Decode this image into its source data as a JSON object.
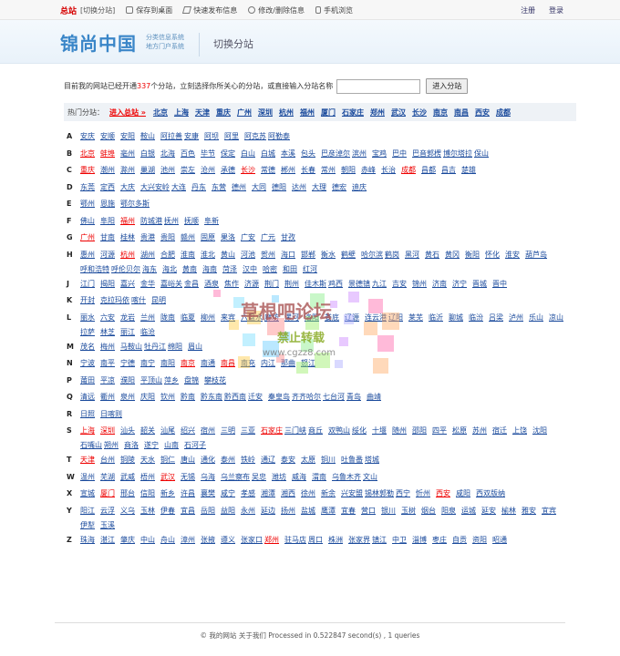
{
  "topbar": {
    "site_label": "总站",
    "switch_label": "[切换分站]",
    "tools": [
      {
        "icon": "monitor-icon",
        "label": "保存到桌面"
      },
      {
        "icon": "lightning-icon",
        "label": "快速发布信息"
      },
      {
        "icon": "gear-icon",
        "label": "修改/删除信息"
      },
      {
        "icon": "phone-icon",
        "label": "手机浏览"
      }
    ],
    "register": "注册",
    "login": "登录"
  },
  "header": {
    "logo": "锦尚中国",
    "logo_sub1": "分类信息系统",
    "logo_sub2": "地方门户系统",
    "title": "切换分站"
  },
  "intro": {
    "pre": "目前我的网站已经开通",
    "count": "337",
    "post": "个分站，立刻选择你所关心的分站，或直接输入分站名称",
    "placeholder": "",
    "button": "进入分站"
  },
  "hot": {
    "label": "热门分站：",
    "current": "进入总站 »",
    "cities": [
      "北京",
      "上海",
      "天津",
      "重庆",
      "广州",
      "深圳",
      "杭州",
      "福州",
      "厦门",
      "石家庄",
      "郑州",
      "武汉",
      "长沙",
      "南京",
      "南昌",
      "西安",
      "成都"
    ]
  },
  "letters": [
    {
      "letter": "A",
      "cities": [
        [
          "安庆",
          0
        ],
        [
          "安顺",
          0
        ],
        [
          "安阳",
          0
        ],
        [
          "鞍山",
          0
        ],
        [
          "阿拉善",
          0
        ],
        [
          "安康",
          0
        ],
        [
          "阿坝",
          0
        ],
        [
          "阿里",
          0
        ],
        [
          "阿克苏",
          0
        ],
        [
          "阿勒泰",
          0
        ]
      ]
    },
    {
      "letter": "B",
      "cities": [
        [
          "北京",
          1
        ],
        [
          "蚌埠",
          1
        ],
        [
          "亳州",
          0
        ],
        [
          "白银",
          0
        ],
        [
          "北海",
          0
        ],
        [
          "百色",
          0
        ],
        [
          "毕节",
          0
        ],
        [
          "保定",
          0
        ],
        [
          "白山",
          0
        ],
        [
          "白城",
          0
        ],
        [
          "本溪",
          0
        ],
        [
          "包头",
          0
        ],
        [
          "巴彦淖尔",
          0
        ],
        [
          "滨州",
          0
        ],
        [
          "宝鸡",
          0
        ],
        [
          "巴中",
          0
        ],
        [
          "巴音郭楞",
          0
        ],
        [
          "博尔塔拉",
          0
        ],
        [
          "保山",
          0
        ]
      ]
    },
    {
      "letter": "C",
      "cities": [
        [
          "重庆",
          1
        ],
        [
          "潮州",
          0
        ],
        [
          "滁州",
          0
        ],
        [
          "巢湖",
          0
        ],
        [
          "池州",
          0
        ],
        [
          "崇左",
          0
        ],
        [
          "沧州",
          0
        ],
        [
          "承德",
          0
        ],
        [
          "长沙",
          1
        ],
        [
          "常德",
          0
        ],
        [
          "郴州",
          0
        ],
        [
          "长春",
          0
        ],
        [
          "常州",
          0
        ],
        [
          "朝阳",
          0
        ],
        [
          "赤峰",
          0
        ],
        [
          "长治",
          0
        ],
        [
          "成都",
          1
        ],
        [
          "昌都",
          0
        ],
        [
          "昌吉",
          0
        ],
        [
          "楚雄",
          0
        ]
      ]
    },
    {
      "letter": "D",
      "cities": [
        [
          "东莞",
          0
        ],
        [
          "定西",
          0
        ],
        [
          "大庆",
          0
        ],
        [
          "大兴安岭",
          0
        ],
        [
          "大连",
          0
        ],
        [
          "丹东",
          0
        ],
        [
          "东营",
          0
        ],
        [
          "德州",
          0
        ],
        [
          "大同",
          0
        ],
        [
          "德阳",
          0
        ],
        [
          "达州",
          0
        ],
        [
          "大理",
          0
        ],
        [
          "德宏",
          0
        ],
        [
          "迪庆",
          0
        ]
      ]
    },
    {
      "letter": "E",
      "cities": [
        [
          "鄂州",
          0
        ],
        [
          "恩施",
          0
        ],
        [
          "鄂尔多斯",
          0
        ]
      ]
    },
    {
      "letter": "F",
      "cities": [
        [
          "佛山",
          0
        ],
        [
          "阜阳",
          0
        ],
        [
          "福州",
          1
        ],
        [
          "防城港",
          0
        ],
        [
          "抚州",
          0
        ],
        [
          "抚顺",
          0
        ],
        [
          "阜新",
          0
        ]
      ]
    },
    {
      "letter": "G",
      "cities": [
        [
          "广州",
          1
        ],
        [
          "甘南",
          0
        ],
        [
          "桂林",
          0
        ],
        [
          "贵港",
          0
        ],
        [
          "贵阳",
          0
        ],
        [
          "赣州",
          0
        ],
        [
          "固原",
          0
        ],
        [
          "果洛",
          0
        ],
        [
          "广安",
          0
        ],
        [
          "广元",
          0
        ],
        [
          "甘孜",
          0
        ]
      ]
    },
    {
      "letter": "H",
      "cities": [
        [
          "惠州",
          0
        ],
        [
          "河源",
          0
        ],
        [
          "杭州",
          1
        ],
        [
          "湖州",
          0
        ],
        [
          "合肥",
          0
        ],
        [
          "淮南",
          0
        ],
        [
          "淮北",
          0
        ],
        [
          "黄山",
          0
        ],
        [
          "河池",
          0
        ],
        [
          "贺州",
          0
        ],
        [
          "海口",
          0
        ],
        [
          "邯郸",
          0
        ],
        [
          "衡水",
          0
        ],
        [
          "鹤壁",
          0
        ],
        [
          "哈尔滨",
          0
        ],
        [
          "鹤岗",
          0
        ],
        [
          "黑河",
          0
        ],
        [
          "黄石",
          0
        ],
        [
          "黄冈",
          0
        ],
        [
          "衡阳",
          0
        ],
        [
          "怀化",
          0
        ],
        [
          "淮安",
          0
        ],
        [
          "葫芦岛",
          0
        ],
        [
          "呼和浩特",
          0
        ],
        [
          "呼伦贝尔",
          0
        ],
        [
          "海东",
          0
        ],
        [
          "海北",
          0
        ],
        [
          "黄南",
          0
        ],
        [
          "海南",
          0
        ],
        [
          "菏泽",
          0
        ],
        [
          "汉中",
          0
        ],
        [
          "哈密",
          0
        ],
        [
          "和田",
          0
        ],
        [
          "红河",
          0
        ]
      ]
    },
    {
      "letter": "J",
      "cities": [
        [
          "江门",
          0
        ],
        [
          "揭阳",
          0
        ],
        [
          "嘉兴",
          0
        ],
        [
          "金华",
          0
        ],
        [
          "嘉峪关",
          0
        ],
        [
          "金昌",
          0
        ],
        [
          "酒泉",
          0
        ],
        [
          "焦作",
          0
        ],
        [
          "济源",
          0
        ],
        [
          "荆门",
          0
        ],
        [
          "荆州",
          0
        ],
        [
          "佳木斯",
          0
        ],
        [
          "鸡西",
          0
        ],
        [
          "景德镇",
          0
        ],
        [
          "九江",
          0
        ],
        [
          "吉安",
          0
        ],
        [
          "锦州",
          0
        ],
        [
          "济南",
          0
        ],
        [
          "济宁",
          0
        ],
        [
          "晋城",
          0
        ],
        [
          "晋中",
          0
        ]
      ]
    },
    {
      "letter": "K",
      "cities": [
        [
          "开封",
          0
        ],
        [
          "克拉玛依",
          0
        ],
        [
          "喀什",
          0
        ],
        [
          "昆明",
          0
        ]
      ]
    },
    {
      "letter": "L",
      "cities": [
        [
          "丽水",
          0
        ],
        [
          "六安",
          0
        ],
        [
          "龙岩",
          0
        ],
        [
          "兰州",
          0
        ],
        [
          "陇南",
          0
        ],
        [
          "临夏",
          0
        ],
        [
          "柳州",
          0
        ],
        [
          "来宾",
          0
        ],
        [
          "六盘水",
          0
        ],
        [
          "廊坊",
          0
        ],
        [
          "漯河",
          0
        ],
        [
          "洛阳",
          0
        ],
        [
          "娄底",
          0
        ],
        [
          "辽源",
          0
        ],
        [
          "连云港",
          0
        ],
        [
          "辽阳",
          0
        ],
        [
          "莱芜",
          0
        ],
        [
          "临沂",
          0
        ],
        [
          "聊城",
          0
        ],
        [
          "临汾",
          0
        ],
        [
          "吕梁",
          0
        ],
        [
          "泸州",
          0
        ],
        [
          "乐山",
          0
        ],
        [
          "凉山",
          0
        ],
        [
          "拉萨",
          0
        ],
        [
          "林芝",
          0
        ],
        [
          "丽江",
          0
        ],
        [
          "临沧",
          0
        ]
      ]
    },
    {
      "letter": "M",
      "cities": [
        [
          "茂名",
          0
        ],
        [
          "梅州",
          0
        ],
        [
          "马鞍山",
          0
        ],
        [
          "牡丹江",
          0
        ],
        [
          "绵阳",
          0
        ],
        [
          "眉山",
          0
        ]
      ]
    },
    {
      "letter": "N",
      "cities": [
        [
          "宁波",
          0
        ],
        [
          "南平",
          0
        ],
        [
          "宁德",
          0
        ],
        [
          "南宁",
          0
        ],
        [
          "南阳",
          0
        ],
        [
          "南京",
          1
        ],
        [
          "南通",
          0
        ],
        [
          "南昌",
          1
        ],
        [
          "南充",
          0
        ],
        [
          "内江",
          0
        ],
        [
          "那曲",
          0
        ],
        [
          "怒江",
          0
        ]
      ]
    },
    {
      "letter": "P",
      "cities": [
        [
          "莆田",
          0
        ],
        [
          "平凉",
          0
        ],
        [
          "濮阳",
          0
        ],
        [
          "平顶山",
          0
        ],
        [
          "萍乡",
          0
        ],
        [
          "盘锦",
          0
        ],
        [
          "攀枝花",
          0
        ]
      ]
    },
    {
      "letter": "Q",
      "cities": [
        [
          "清远",
          0
        ],
        [
          "衢州",
          0
        ],
        [
          "泉州",
          0
        ],
        [
          "庆阳",
          0
        ],
        [
          "钦州",
          0
        ],
        [
          "黔南",
          0
        ],
        [
          "黔东南",
          0
        ],
        [
          "黔西南",
          0
        ],
        [
          "迁安",
          0
        ],
        [
          "秦皇岛",
          0
        ],
        [
          "齐齐哈尔",
          0
        ],
        [
          "七台河",
          0
        ],
        [
          "青岛",
          0
        ],
        [
          "曲靖",
          0
        ]
      ]
    },
    {
      "letter": "R",
      "cities": [
        [
          "日照",
          0
        ],
        [
          "日喀则",
          0
        ]
      ]
    },
    {
      "letter": "S",
      "cities": [
        [
          "上海",
          1
        ],
        [
          "深圳",
          1
        ],
        [
          "汕头",
          0
        ],
        [
          "韶关",
          0
        ],
        [
          "汕尾",
          0
        ],
        [
          "绍兴",
          0
        ],
        [
          "宿州",
          0
        ],
        [
          "三明",
          0
        ],
        [
          "三亚",
          0
        ],
        [
          "石家庄",
          1
        ],
        [
          "三门峡",
          0
        ],
        [
          "商丘",
          0
        ],
        [
          "双鸭山",
          0
        ],
        [
          "绥化",
          0
        ],
        [
          "十堰",
          0
        ],
        [
          "随州",
          0
        ],
        [
          "邵阳",
          0
        ],
        [
          "四平",
          0
        ],
        [
          "松原",
          0
        ],
        [
          "苏州",
          0
        ],
        [
          "宿迁",
          0
        ],
        [
          "上饶",
          0
        ],
        [
          "沈阳",
          0
        ],
        [
          "石嘴山",
          0
        ],
        [
          "朔州",
          0
        ],
        [
          "商洛",
          0
        ],
        [
          "遂宁",
          0
        ],
        [
          "山南",
          0
        ],
        [
          "石河子",
          0
        ]
      ]
    },
    {
      "letter": "T",
      "cities": [
        [
          "天津",
          1
        ],
        [
          "台州",
          0
        ],
        [
          "铜陵",
          0
        ],
        [
          "天水",
          0
        ],
        [
          "铜仁",
          0
        ],
        [
          "唐山",
          0
        ],
        [
          "通化",
          0
        ],
        [
          "泰州",
          0
        ],
        [
          "铁岭",
          0
        ],
        [
          "通辽",
          0
        ],
        [
          "泰安",
          0
        ],
        [
          "太原",
          0
        ],
        [
          "铜川",
          0
        ],
        [
          "吐鲁番",
          0
        ],
        [
          "塔城",
          0
        ]
      ]
    },
    {
      "letter": "W",
      "cities": [
        [
          "温州",
          0
        ],
        [
          "芜湖",
          0
        ],
        [
          "武威",
          0
        ],
        [
          "梧州",
          0
        ],
        [
          "武汉",
          1
        ],
        [
          "无锡",
          0
        ],
        [
          "乌海",
          0
        ],
        [
          "乌兰察布",
          0
        ],
        [
          "吴忠",
          0
        ],
        [
          "潍坊",
          0
        ],
        [
          "威海",
          0
        ],
        [
          "渭南",
          0
        ],
        [
          "乌鲁木齐",
          0
        ],
        [
          "文山",
          0
        ]
      ]
    },
    {
      "letter": "X",
      "cities": [
        [
          "宣城",
          0
        ],
        [
          "厦门",
          1
        ],
        [
          "邢台",
          0
        ],
        [
          "信阳",
          0
        ],
        [
          "新乡",
          0
        ],
        [
          "许昌",
          0
        ],
        [
          "襄樊",
          0
        ],
        [
          "咸宁",
          0
        ],
        [
          "孝感",
          0
        ],
        [
          "湘潭",
          0
        ],
        [
          "湘西",
          0
        ],
        [
          "徐州",
          0
        ],
        [
          "新余",
          0
        ],
        [
          "兴安盟",
          0
        ],
        [
          "锡林郭勒",
          0
        ],
        [
          "西宁",
          0
        ],
        [
          "忻州",
          0
        ],
        [
          "西安",
          1
        ],
        [
          "咸阳",
          0
        ],
        [
          "西双版纳",
          0
        ]
      ]
    },
    {
      "letter": "Y",
      "cities": [
        [
          "阳江",
          0
        ],
        [
          "云浮",
          0
        ],
        [
          "义乌",
          0
        ],
        [
          "玉林",
          0
        ],
        [
          "伊春",
          0
        ],
        [
          "宜昌",
          0
        ],
        [
          "岳阳",
          0
        ],
        [
          "益阳",
          0
        ],
        [
          "永州",
          0
        ],
        [
          "延边",
          0
        ],
        [
          "扬州",
          0
        ],
        [
          "盐城",
          0
        ],
        [
          "鹰潭",
          0
        ],
        [
          "宜春",
          0
        ],
        [
          "营口",
          0
        ],
        [
          "银川",
          0
        ],
        [
          "玉树",
          0
        ],
        [
          "烟台",
          0
        ],
        [
          "阳泉",
          0
        ],
        [
          "运城",
          0
        ],
        [
          "延安",
          0
        ],
        [
          "榆林",
          0
        ],
        [
          "雅安",
          0
        ],
        [
          "宜宾",
          0
        ],
        [
          "伊犁",
          0
        ],
        [
          "玉溪",
          0
        ]
      ]
    },
    {
      "letter": "Z",
      "cities": [
        [
          "珠海",
          0
        ],
        [
          "湛江",
          0
        ],
        [
          "肇庆",
          0
        ],
        [
          "中山",
          0
        ],
        [
          "舟山",
          0
        ],
        [
          "漳州",
          0
        ],
        [
          "张掖",
          0
        ],
        [
          "遵义",
          0
        ],
        [
          "张家口",
          0
        ],
        [
          "郑州",
          1
        ],
        [
          "驻马店",
          0
        ],
        [
          "周口",
          0
        ],
        [
          "株洲",
          0
        ],
        [
          "张家界",
          0
        ],
        [
          "镇江",
          0
        ],
        [
          "中卫",
          0
        ],
        [
          "淄博",
          0
        ],
        [
          "枣庄",
          0
        ],
        [
          "自贡",
          0
        ],
        [
          "资阳",
          0
        ],
        [
          "昭通",
          0
        ]
      ]
    }
  ],
  "watermark": {
    "line1": "草根吧论坛",
    "line2": "禁止转载",
    "line3": "www.cgzz8.com"
  },
  "footer": {
    "text": "© 我的网站   关于我们 Processed in 0.522847 second(s) , 1 queries"
  }
}
